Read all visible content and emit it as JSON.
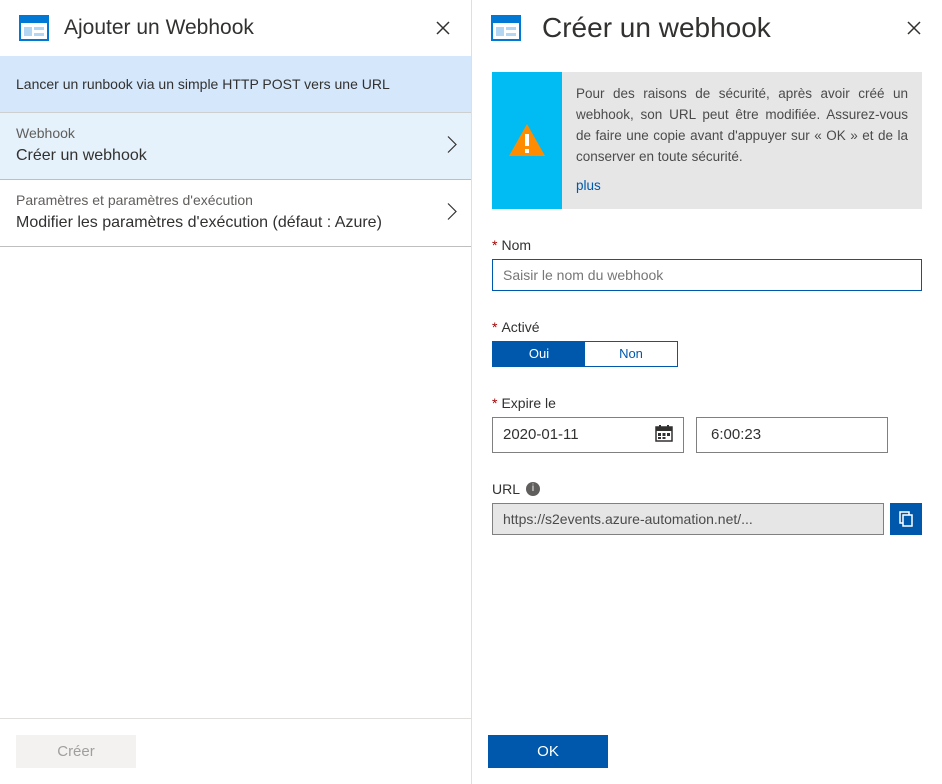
{
  "left": {
    "title": "Ajouter un Webhook",
    "info": "Lancer un runbook via un simple HTTP POST vers une URL",
    "items": [
      {
        "label": "Webhook",
        "value": "Créer un webhook",
        "active": true
      },
      {
        "label": "Paramètres et paramètres d'exécution",
        "value": "Modifier les paramètres d'exécution (défaut : Azure)",
        "active": false
      }
    ],
    "create_button": "Créer"
  },
  "right": {
    "title": "Créer un webhook",
    "warning": {
      "text": "Pour des raisons de sécurité, après avoir créé un webhook, son URL peut être modifiée. Assurez-vous de faire une copie avant d'appuyer sur « OK » et de la conserver en toute sécurité.",
      "more": "plus"
    },
    "name": {
      "label": "Nom",
      "placeholder": "Saisir le nom du webhook",
      "value": ""
    },
    "enabled": {
      "label": "Activé",
      "yes": "Oui",
      "no": "Non"
    },
    "expires": {
      "label": "Expire le",
      "date": "2020-01-11",
      "time": "6:00:23"
    },
    "url": {
      "label": "URL",
      "value": "https://s2events.azure-automation.net/..."
    },
    "ok_button": "OK"
  }
}
